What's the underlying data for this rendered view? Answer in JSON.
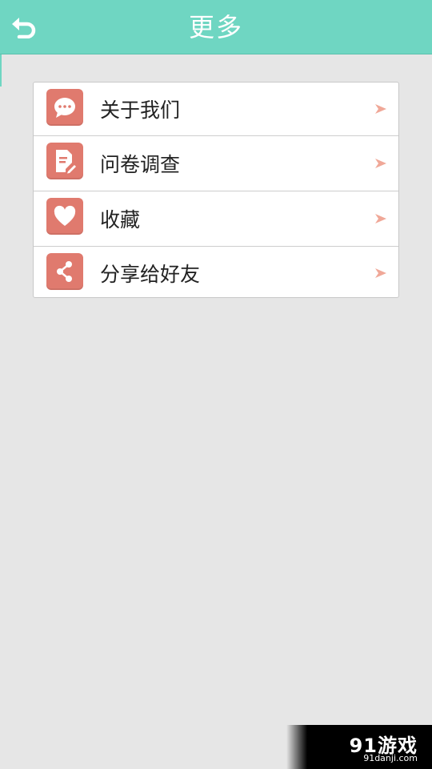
{
  "header": {
    "title": "更多",
    "back_icon": "back-arrow-icon",
    "color": "#6fd6c2"
  },
  "menu": {
    "items": [
      {
        "label": "关于我们",
        "icon": "chat-bubble-icon"
      },
      {
        "label": "问卷调查",
        "icon": "document-edit-icon"
      },
      {
        "label": "收藏",
        "icon": "heart-icon"
      },
      {
        "label": "分享给好友",
        "icon": "share-icon"
      }
    ],
    "icon_color": "#e07a6e",
    "arrow_color": "#f0a898"
  },
  "watermark": {
    "logo": "91游戏",
    "url": "91danji.com"
  }
}
